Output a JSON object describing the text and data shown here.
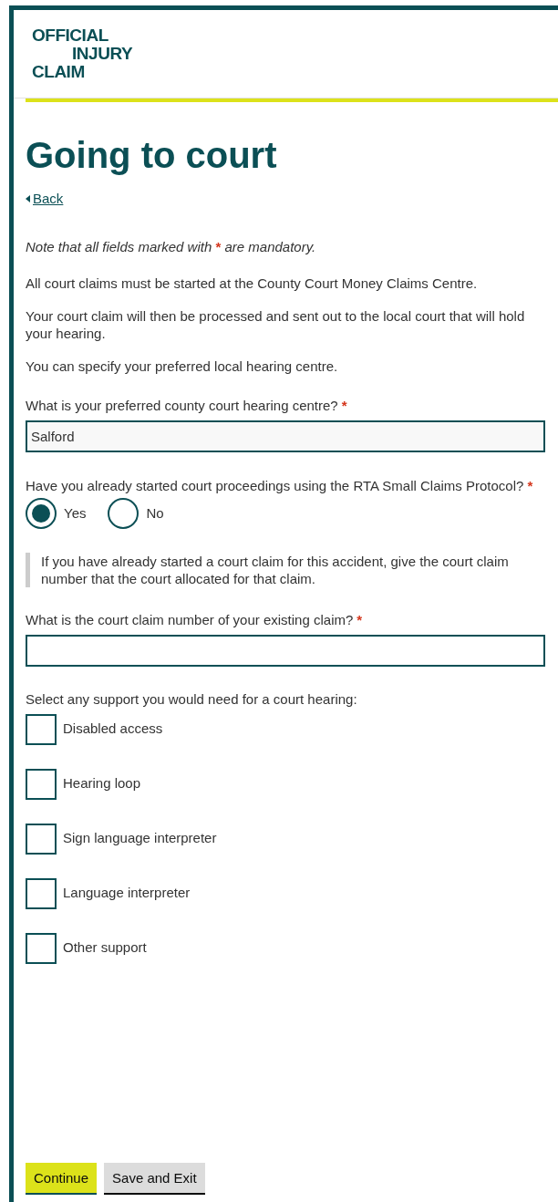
{
  "logo": {
    "lines": [
      "OFFICIAL",
      "INJURY",
      "CLAIM"
    ]
  },
  "title": "Going to court",
  "back_link": "Back",
  "note": {
    "before": "Note that all fields marked with",
    "mark": "*",
    "after": "are mandatory."
  },
  "intro": [
    "All court claims must be started at the County Court Money Claims Centre.",
    "Your court claim will then be processed and sent out to the local court that will hold your hearing.",
    "You can specify your preferred local hearing centre."
  ],
  "hearing_centre": {
    "label": "What is your preferred county court hearing centre?",
    "required": true,
    "value": "Salford"
  },
  "proceedings": {
    "label": "Have you already started court proceedings using the RTA Small Claims Protocol?",
    "required": true,
    "options": [
      {
        "label": "Yes",
        "selected": true
      },
      {
        "label": "No",
        "selected": false
      }
    ]
  },
  "hint": "If you have already started a court claim for this accident, give the court claim number that the court allocated for that claim.",
  "claim_number": {
    "label": "What is the court claim number of your existing claim?",
    "required": true
  },
  "support": {
    "label": "Select any support you would need for a court hearing:",
    "options": [
      {
        "label": "Disabled access",
        "checked": false
      },
      {
        "label": "Hearing loop",
        "checked": false
      },
      {
        "label": "Sign language interpreter",
        "checked": false
      },
      {
        "label": "Language interpreter",
        "checked": false
      },
      {
        "label": "Other support",
        "checked": false
      }
    ]
  },
  "buttons": [
    {
      "label": "Continue",
      "kind": "primary"
    },
    {
      "label": "Save and Exit",
      "kind": "secondary"
    }
  ]
}
